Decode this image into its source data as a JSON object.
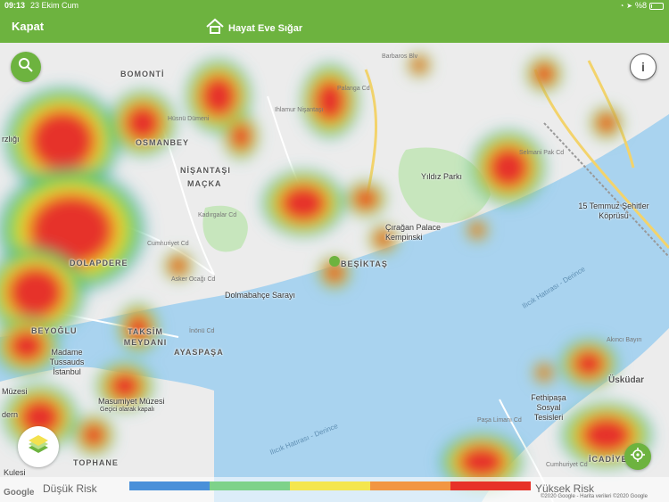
{
  "status_bar": {
    "time": "09:13",
    "date": "23 Ekim Cum",
    "battery": "%8"
  },
  "header": {
    "close_label": "Kapat",
    "app_title": "Hayat Eve Sığar",
    "brand_color": "#6db33f"
  },
  "map": {
    "district_labels": [
      "BOMONTİ",
      "OSMANBEY",
      "NİŞANTAŞI",
      "MAÇKA",
      "DOLAPDERE",
      "BEYOĞLU",
      "TAKSİM MEYDANI",
      "AYASPAŞA",
      "TOPHANE",
      "BEŞİKTAŞ",
      "Üsküdar",
      "İCADİYE"
    ],
    "poi_labels": [
      "Yıldız Parkı",
      "Çırağan Palace Kempinski",
      "Dolmabahçe Sarayı",
      "Madame Tussauds İstanbul",
      "Masumiyet Müzesi",
      "Geçici olarak kapalı",
      "15 Temmuz Şehitler Köprüsü",
      "Fethipaşa Sosyal Tesisleri",
      "Barbaros Blv",
      "Palanga Cd",
      "Ihlamur Nişantaşı",
      "Hüsnü Dümeni",
      "Kadırgalar Cd",
      "Asker Ocağı Cd",
      "İnönü Cd",
      "Cumhuriyet Cd",
      "Kulesi",
      "rzlığı",
      "Müzesi",
      "dern",
      "Akıncı Bayırı",
      "Paşa Limanı Cd",
      "Selmani Pak Cd",
      "Cumhuriyet Cd"
    ],
    "water_labels": [
      "Ilıcık Hatırası - Derince",
      "Ilıcık Hatırası - Derince"
    ],
    "heat_colors": [
      "#e63329",
      "#f3e62c",
      "#54c95a",
      "#3b8fe6"
    ]
  },
  "legend": {
    "low_label": "Düşük Risk",
    "high_label": "Yüksek Risk",
    "colors": [
      "#4a90d9",
      "#7ed28a",
      "#f4e64e",
      "#f29642",
      "#e73228"
    ]
  },
  "attribution": {
    "google": "Google",
    "text": "©2020 Google - Harita verileri ©2020 Google"
  },
  "icons": {
    "search": "search-icon",
    "info": "info-icon",
    "locate": "locate-icon",
    "layers": "map-layers-icon",
    "logo": "home-logo-icon"
  }
}
